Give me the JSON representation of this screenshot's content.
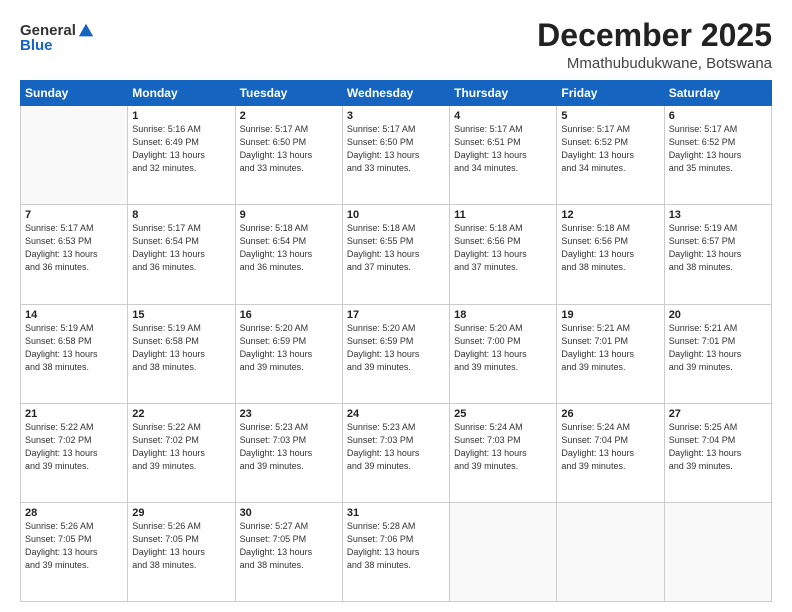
{
  "logo": {
    "general": "General",
    "blue": "Blue"
  },
  "header": {
    "title": "December 2025",
    "location": "Mmathubudukwane, Botswana"
  },
  "weekdays": [
    "Sunday",
    "Monday",
    "Tuesday",
    "Wednesday",
    "Thursday",
    "Friday",
    "Saturday"
  ],
  "weeks": [
    [
      {
        "day": "",
        "content": ""
      },
      {
        "day": "1",
        "content": "Sunrise: 5:16 AM\nSunset: 6:49 PM\nDaylight: 13 hours\nand 32 minutes."
      },
      {
        "day": "2",
        "content": "Sunrise: 5:17 AM\nSunset: 6:50 PM\nDaylight: 13 hours\nand 33 minutes."
      },
      {
        "day": "3",
        "content": "Sunrise: 5:17 AM\nSunset: 6:50 PM\nDaylight: 13 hours\nand 33 minutes."
      },
      {
        "day": "4",
        "content": "Sunrise: 5:17 AM\nSunset: 6:51 PM\nDaylight: 13 hours\nand 34 minutes."
      },
      {
        "day": "5",
        "content": "Sunrise: 5:17 AM\nSunset: 6:52 PM\nDaylight: 13 hours\nand 34 minutes."
      },
      {
        "day": "6",
        "content": "Sunrise: 5:17 AM\nSunset: 6:52 PM\nDaylight: 13 hours\nand 35 minutes."
      }
    ],
    [
      {
        "day": "7",
        "content": "Sunrise: 5:17 AM\nSunset: 6:53 PM\nDaylight: 13 hours\nand 36 minutes."
      },
      {
        "day": "8",
        "content": "Sunrise: 5:17 AM\nSunset: 6:54 PM\nDaylight: 13 hours\nand 36 minutes."
      },
      {
        "day": "9",
        "content": "Sunrise: 5:18 AM\nSunset: 6:54 PM\nDaylight: 13 hours\nand 36 minutes."
      },
      {
        "day": "10",
        "content": "Sunrise: 5:18 AM\nSunset: 6:55 PM\nDaylight: 13 hours\nand 37 minutes."
      },
      {
        "day": "11",
        "content": "Sunrise: 5:18 AM\nSunset: 6:56 PM\nDaylight: 13 hours\nand 37 minutes."
      },
      {
        "day": "12",
        "content": "Sunrise: 5:18 AM\nSunset: 6:56 PM\nDaylight: 13 hours\nand 38 minutes."
      },
      {
        "day": "13",
        "content": "Sunrise: 5:19 AM\nSunset: 6:57 PM\nDaylight: 13 hours\nand 38 minutes."
      }
    ],
    [
      {
        "day": "14",
        "content": "Sunrise: 5:19 AM\nSunset: 6:58 PM\nDaylight: 13 hours\nand 38 minutes."
      },
      {
        "day": "15",
        "content": "Sunrise: 5:19 AM\nSunset: 6:58 PM\nDaylight: 13 hours\nand 38 minutes."
      },
      {
        "day": "16",
        "content": "Sunrise: 5:20 AM\nSunset: 6:59 PM\nDaylight: 13 hours\nand 39 minutes."
      },
      {
        "day": "17",
        "content": "Sunrise: 5:20 AM\nSunset: 6:59 PM\nDaylight: 13 hours\nand 39 minutes."
      },
      {
        "day": "18",
        "content": "Sunrise: 5:20 AM\nSunset: 7:00 PM\nDaylight: 13 hours\nand 39 minutes."
      },
      {
        "day": "19",
        "content": "Sunrise: 5:21 AM\nSunset: 7:01 PM\nDaylight: 13 hours\nand 39 minutes."
      },
      {
        "day": "20",
        "content": "Sunrise: 5:21 AM\nSunset: 7:01 PM\nDaylight: 13 hours\nand 39 minutes."
      }
    ],
    [
      {
        "day": "21",
        "content": "Sunrise: 5:22 AM\nSunset: 7:02 PM\nDaylight: 13 hours\nand 39 minutes."
      },
      {
        "day": "22",
        "content": "Sunrise: 5:22 AM\nSunset: 7:02 PM\nDaylight: 13 hours\nand 39 minutes."
      },
      {
        "day": "23",
        "content": "Sunrise: 5:23 AM\nSunset: 7:03 PM\nDaylight: 13 hours\nand 39 minutes."
      },
      {
        "day": "24",
        "content": "Sunrise: 5:23 AM\nSunset: 7:03 PM\nDaylight: 13 hours\nand 39 minutes."
      },
      {
        "day": "25",
        "content": "Sunrise: 5:24 AM\nSunset: 7:03 PM\nDaylight: 13 hours\nand 39 minutes."
      },
      {
        "day": "26",
        "content": "Sunrise: 5:24 AM\nSunset: 7:04 PM\nDaylight: 13 hours\nand 39 minutes."
      },
      {
        "day": "27",
        "content": "Sunrise: 5:25 AM\nSunset: 7:04 PM\nDaylight: 13 hours\nand 39 minutes."
      }
    ],
    [
      {
        "day": "28",
        "content": "Sunrise: 5:26 AM\nSunset: 7:05 PM\nDaylight: 13 hours\nand 39 minutes."
      },
      {
        "day": "29",
        "content": "Sunrise: 5:26 AM\nSunset: 7:05 PM\nDaylight: 13 hours\nand 38 minutes."
      },
      {
        "day": "30",
        "content": "Sunrise: 5:27 AM\nSunset: 7:05 PM\nDaylight: 13 hours\nand 38 minutes."
      },
      {
        "day": "31",
        "content": "Sunrise: 5:28 AM\nSunset: 7:06 PM\nDaylight: 13 hours\nand 38 minutes."
      },
      {
        "day": "",
        "content": ""
      },
      {
        "day": "",
        "content": ""
      },
      {
        "day": "",
        "content": ""
      }
    ]
  ]
}
